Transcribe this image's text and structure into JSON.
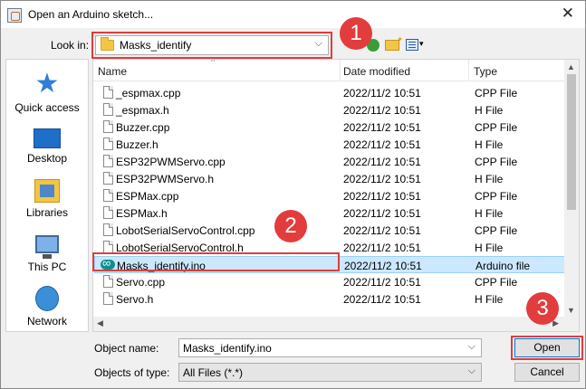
{
  "window": {
    "title": "Open an Arduino sketch...",
    "close_glyph": "✕"
  },
  "lookin": {
    "label": "Look in:",
    "value": "Masks_identify",
    "arrow": "⌵"
  },
  "places": [
    {
      "name": "quick-access",
      "label": "Quick access",
      "icon": "star-icon"
    },
    {
      "name": "desktop",
      "label": "Desktop",
      "icon": "desktop-icon"
    },
    {
      "name": "libraries",
      "label": "Libraries",
      "icon": "libraries-icon"
    },
    {
      "name": "this-pc",
      "label": "This PC",
      "icon": "pc-icon"
    },
    {
      "name": "network",
      "label": "Network",
      "icon": "network-icon"
    }
  ],
  "columns": {
    "name": "Name",
    "date": "Date modified",
    "type": "Type"
  },
  "files": [
    {
      "name": "_espmax.cpp",
      "date": "2022/11/2 10:51",
      "type": "CPP File",
      "icon": "file-icon"
    },
    {
      "name": "_espmax.h",
      "date": "2022/11/2 10:51",
      "type": "H File",
      "icon": "file-icon"
    },
    {
      "name": "Buzzer.cpp",
      "date": "2022/11/2 10:51",
      "type": "CPP File",
      "icon": "file-icon"
    },
    {
      "name": "Buzzer.h",
      "date": "2022/11/2 10:51",
      "type": "H File",
      "icon": "file-icon"
    },
    {
      "name": "ESP32PWMServo.cpp",
      "date": "2022/11/2 10:51",
      "type": "CPP File",
      "icon": "file-icon"
    },
    {
      "name": "ESP32PWMServo.h",
      "date": "2022/11/2 10:51",
      "type": "H File",
      "icon": "file-icon"
    },
    {
      "name": "ESPMax.cpp",
      "date": "2022/11/2 10:51",
      "type": "CPP File",
      "icon": "file-icon"
    },
    {
      "name": "ESPMax.h",
      "date": "2022/11/2 10:51",
      "type": "H File",
      "icon": "file-icon"
    },
    {
      "name": "LobotSerialServoControl.cpp",
      "date": "2022/11/2 10:51",
      "type": "CPP File",
      "icon": "file-icon"
    },
    {
      "name": "LobotSerialServoControl.h",
      "date": "2022/11/2 10:51",
      "type": "H File",
      "icon": "file-icon"
    },
    {
      "name": "Masks_identify.ino",
      "date": "2022/11/2 10:51",
      "type": "Arduino file",
      "icon": "ino-icon",
      "selected": true
    },
    {
      "name": "Servo.cpp",
      "date": "2022/11/2 10:51",
      "type": "CPP File",
      "icon": "file-icon"
    },
    {
      "name": "Servo.h",
      "date": "2022/11/2 10:51",
      "type": "H File",
      "icon": "file-icon"
    }
  ],
  "object_name": {
    "label": "Object name:",
    "value": "Masks_identify.ino"
  },
  "object_type": {
    "label": "Objects of type:",
    "value": "All Files (*.*)"
  },
  "buttons": {
    "open": "Open",
    "cancel": "Cancel"
  },
  "annotations": {
    "badge1": "1",
    "badge2": "2",
    "badge3": "3",
    "color": "#e23c3c"
  }
}
